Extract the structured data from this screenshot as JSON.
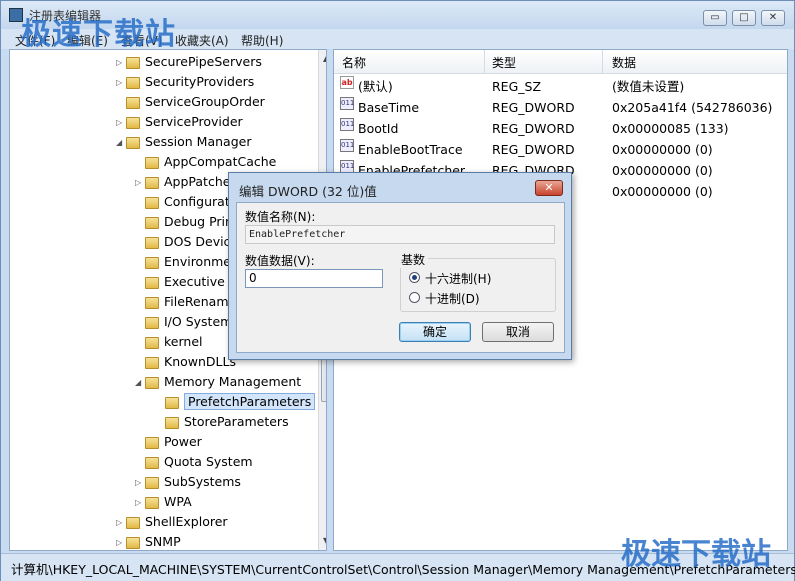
{
  "app": {
    "title": "注册表编辑器",
    "watermark": "极速下载站"
  },
  "window_controls": {
    "minimize": "▭",
    "maximize": "□",
    "close": "✕"
  },
  "menu": [
    "文件(F)",
    "编辑(E)",
    "查看(V)",
    "收藏夹(A)",
    "帮助(H)"
  ],
  "tree": [
    {
      "label": "SecurePipeServers",
      "level": 0,
      "expander": "▷"
    },
    {
      "label": "SecurityProviders",
      "level": 0,
      "expander": "▷"
    },
    {
      "label": "ServiceGroupOrder",
      "level": 0,
      "expander": ""
    },
    {
      "label": "ServiceProvider",
      "level": 0,
      "expander": "▷"
    },
    {
      "label": "Session Manager",
      "level": 0,
      "expander": "◢"
    },
    {
      "label": "AppCompatCache",
      "level": 1,
      "expander": ""
    },
    {
      "label": "AppPatches",
      "level": 1,
      "expander": "▷"
    },
    {
      "label": "Configuration Manager",
      "level": 1,
      "expander": ""
    },
    {
      "label": "Debug Print Filter",
      "level": 1,
      "expander": ""
    },
    {
      "label": "DOS Devices",
      "level": 1,
      "expander": ""
    },
    {
      "label": "Environment",
      "level": 1,
      "expander": ""
    },
    {
      "label": "Executive",
      "level": 1,
      "expander": ""
    },
    {
      "label": "FileRenameOperations",
      "level": 1,
      "expander": ""
    },
    {
      "label": "I/O System",
      "level": 1,
      "expander": ""
    },
    {
      "label": "kernel",
      "level": 1,
      "expander": ""
    },
    {
      "label": "KnownDLLs",
      "level": 1,
      "expander": ""
    },
    {
      "label": "Memory Management",
      "level": 1,
      "expander": "◢"
    },
    {
      "label": "PrefetchParameters",
      "level": 2,
      "expander": "",
      "selected": true
    },
    {
      "label": "StoreParameters",
      "level": 2,
      "expander": ""
    },
    {
      "label": "Power",
      "level": 1,
      "expander": ""
    },
    {
      "label": "Quota System",
      "level": 1,
      "expander": ""
    },
    {
      "label": "SubSystems",
      "level": 1,
      "expander": "▷"
    },
    {
      "label": "WPA",
      "level": 1,
      "expander": "▷"
    },
    {
      "label": "ShellExplorer",
      "level": 0,
      "expander": "▷"
    },
    {
      "label": "SNMP",
      "level": 0,
      "expander": "▷"
    }
  ],
  "list": {
    "headers": {
      "name": "名称",
      "type": "类型",
      "data": "数据"
    },
    "rows": [
      {
        "icon": "ab",
        "name": "(默认)",
        "type": "REG_SZ",
        "data": "(数值未设置)"
      },
      {
        "icon": "bin",
        "name": "BaseTime",
        "type": "REG_DWORD",
        "data": "0x205a41f4 (542786036)"
      },
      {
        "icon": "bin",
        "name": "BootId",
        "type": "REG_DWORD",
        "data": "0x00000085 (133)"
      },
      {
        "icon": "bin",
        "name": "EnableBootTrace",
        "type": "REG_DWORD",
        "data": "0x00000000 (0)"
      },
      {
        "icon": "bin",
        "name": "EnablePrefetcher",
        "type": "REG_DWORD",
        "data": "0x00000000 (0)"
      },
      {
        "icon": "bin",
        "name": "",
        "type": "",
        "data": "0x00000000 (0)"
      }
    ]
  },
  "status": "计算机\\HKEY_LOCAL_MACHINE\\SYSTEM\\CurrentControlSet\\Control\\Session Manager\\Memory Management\\PrefetchParameters",
  "dialog": {
    "title": "编辑 DWORD (32 位)值",
    "close": "✕",
    "name_label": "数值名称(N):",
    "name_value": "EnablePrefetcher",
    "data_label": "数值数据(V):",
    "data_value": "0",
    "base_label": "基数",
    "hex_label": "十六进制(H)",
    "dec_label": "十进制(D)",
    "ok": "确定",
    "cancel": "取消"
  }
}
